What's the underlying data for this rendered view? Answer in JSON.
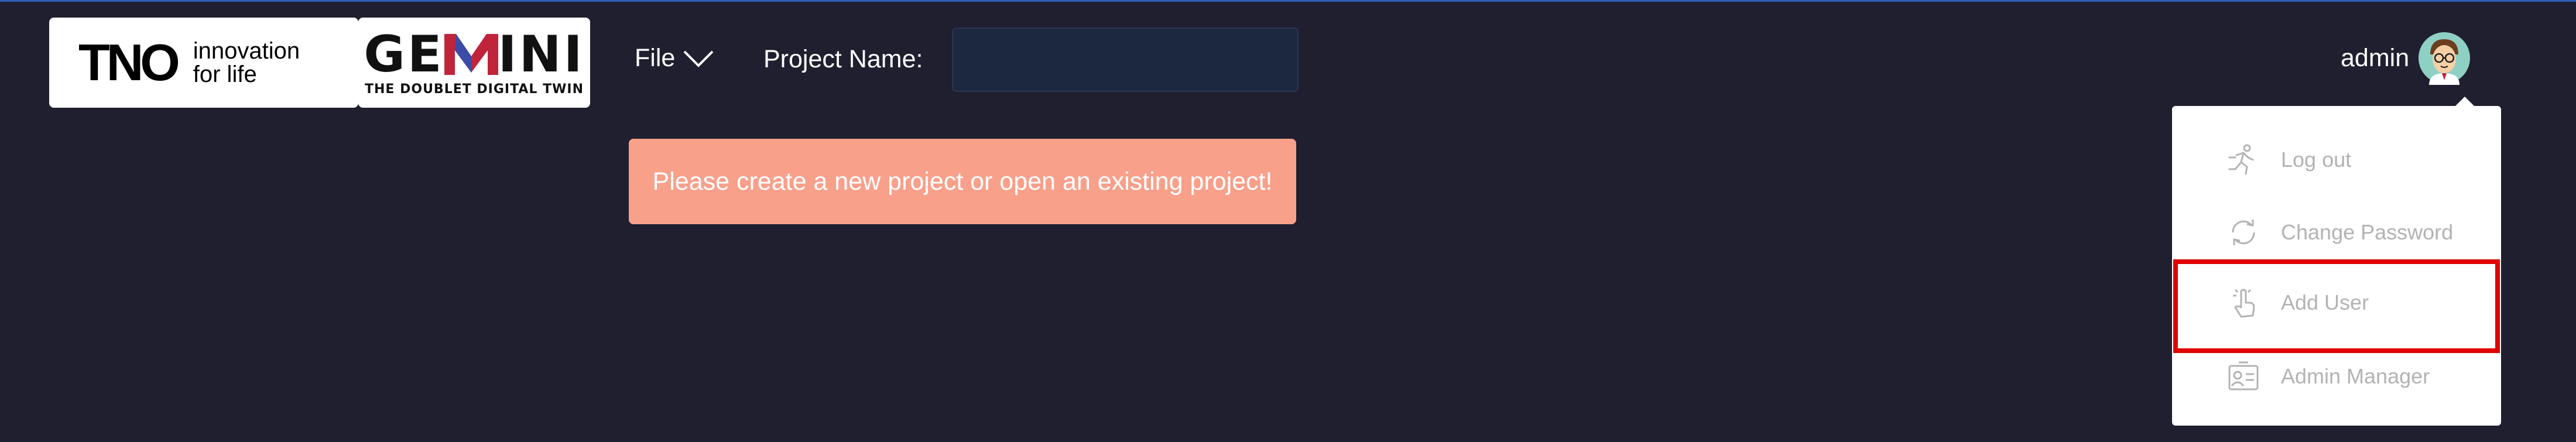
{
  "header": {
    "tno_logo": {
      "mark": "TNO",
      "tagline_line1": "innovation",
      "tagline_line2": "for life"
    },
    "gemini_logo": {
      "word_left": "GE",
      "word_right": "INI",
      "subtitle": "THE DOUBLET DIGITAL TWIN"
    },
    "file_menu_label": "File",
    "project_name_label": "Project Name:",
    "project_name_value": ""
  },
  "alert": {
    "message": "Please create a new project or open an existing project!"
  },
  "user": {
    "name": "admin",
    "menu": {
      "logout": "Log out",
      "change_password": "Change Password",
      "add_user": "Add User",
      "admin_manager": "Admin Manager"
    }
  },
  "colors": {
    "background": "#1f1f30",
    "alert": "#f9a08b",
    "highlight": "#e00000",
    "menu_text": "#b3b3b3"
  }
}
